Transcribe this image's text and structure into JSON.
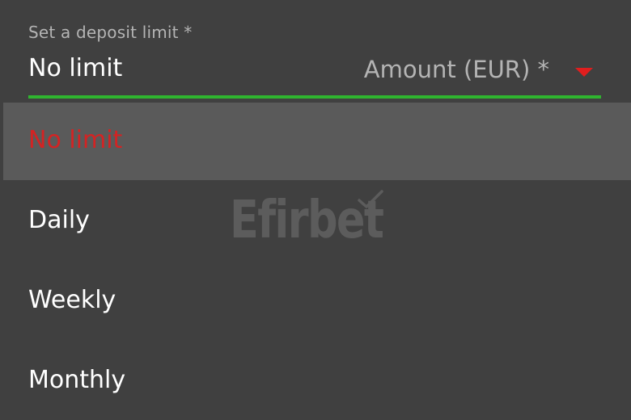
{
  "form": {
    "label": "Set a deposit limit *",
    "selected_value": "No limit",
    "amount_label": "Amount (EUR) *",
    "caret_icon": "caret-down-icon",
    "accent_color": "#2fb52f",
    "caret_color": "#e01e1e"
  },
  "dropdown": {
    "options": [
      {
        "label": "No limit",
        "highlighted": true
      },
      {
        "label": "Daily",
        "highlighted": false
      },
      {
        "label": "Weekly",
        "highlighted": false
      },
      {
        "label": "Monthly",
        "highlighted": false
      }
    ],
    "highlight_color": "#d42323"
  },
  "watermark": {
    "text": "Efirbet"
  }
}
